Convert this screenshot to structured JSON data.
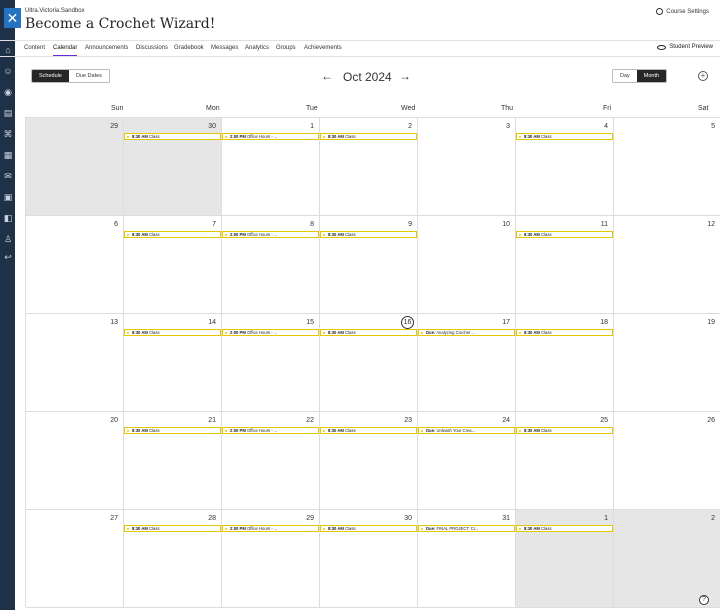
{
  "header": {
    "org": "Ultra.Victoria.Sandbox",
    "title": "Become a Crochet Wizard!",
    "settings_label": "Course Settings",
    "close_glyph": "✕"
  },
  "nav": {
    "tabs": [
      "Content",
      "Calendar",
      "Announcements",
      "Discussions",
      "Gradebook",
      "Messages",
      "Analytics",
      "Groups",
      "Achievements"
    ],
    "active": "Calendar",
    "student_preview": "Student Preview"
  },
  "toolbar": {
    "schedule": "Schedule",
    "due_dates": "Due Dates",
    "month_label": "Oct 2024",
    "prev": "←",
    "next": "→",
    "day": "Day",
    "month": "Month",
    "add": "+"
  },
  "calendar": {
    "weekdays": [
      "Sun",
      "Mon",
      "Tue",
      "Wed",
      "Thu",
      "Fri",
      "Sat"
    ],
    "today": 16,
    "weeks": [
      [
        {
          "d": "29",
          "out": true,
          "ev": null
        },
        {
          "d": "30",
          "out": true,
          "ev": {
            "t": "8:30 AM",
            "x": "Class"
          }
        },
        {
          "d": "1",
          "ev": {
            "t": "2:00 PM",
            "x": "Office Hours - ..."
          }
        },
        {
          "d": "2",
          "ev": {
            "t": "8:30 AM",
            "x": "Class"
          }
        },
        {
          "d": "3",
          "ev": null
        },
        {
          "d": "4",
          "ev": {
            "t": "8:30 AM",
            "x": "Class"
          }
        },
        {
          "d": "5",
          "ev": null
        }
      ],
      [
        {
          "d": "6",
          "ev": null
        },
        {
          "d": "7",
          "ev": {
            "t": "8:30 AM",
            "x": "Class"
          }
        },
        {
          "d": "8",
          "ev": {
            "t": "2:00 PM",
            "x": "Office Hours - ..."
          }
        },
        {
          "d": "9",
          "ev": {
            "t": "8:30 AM",
            "x": "Class"
          }
        },
        {
          "d": "10",
          "ev": null
        },
        {
          "d": "11",
          "ev": {
            "t": "8:30 AM",
            "x": "Class"
          }
        },
        {
          "d": "12",
          "ev": null
        }
      ],
      [
        {
          "d": "13",
          "ev": null
        },
        {
          "d": "14",
          "ev": {
            "t": "8:30 AM",
            "x": "Class"
          }
        },
        {
          "d": "15",
          "ev": {
            "t": "2:00 PM",
            "x": "Office Hours - ..."
          }
        },
        {
          "d": "16",
          "ev": {
            "t": "8:30 AM",
            "x": "Class"
          }
        },
        {
          "d": "17",
          "ev": {
            "t": "Due:",
            "x": "Analyzing Crochet ..."
          }
        },
        {
          "d": "18",
          "ev": {
            "t": "8:30 AM",
            "x": "Class"
          }
        },
        {
          "d": "19",
          "ev": null
        }
      ],
      [
        {
          "d": "20",
          "ev": null
        },
        {
          "d": "21",
          "ev": {
            "t": "8:30 AM",
            "x": "Class"
          }
        },
        {
          "d": "22",
          "ev": {
            "t": "2:00 PM",
            "x": "Office Hours - ..."
          }
        },
        {
          "d": "23",
          "ev": {
            "t": "8:30 AM",
            "x": "Class"
          }
        },
        {
          "d": "24",
          "ev": {
            "t": "Due:",
            "x": "Unleash Your Crea..."
          }
        },
        {
          "d": "25",
          "ev": {
            "t": "8:30 AM",
            "x": "Class"
          }
        },
        {
          "d": "26",
          "ev": null
        }
      ],
      [
        {
          "d": "27",
          "ev": null
        },
        {
          "d": "28",
          "ev": {
            "t": "8:30 AM",
            "x": "Class"
          }
        },
        {
          "d": "29",
          "ev": {
            "t": "2:00 PM",
            "x": "Office Hours - ..."
          }
        },
        {
          "d": "30",
          "ev": {
            "t": "8:30 AM",
            "x": "Class"
          }
        },
        {
          "d": "31",
          "ev": {
            "t": "Due:",
            "x": "FINAL PROJECT: Cr..."
          }
        },
        {
          "d": "1",
          "out": true,
          "ev": {
            "t": "8:30 AM",
            "x": "Class"
          }
        },
        {
          "d": "2",
          "out": true,
          "ev": null
        }
      ]
    ]
  },
  "help_glyph": "?"
}
